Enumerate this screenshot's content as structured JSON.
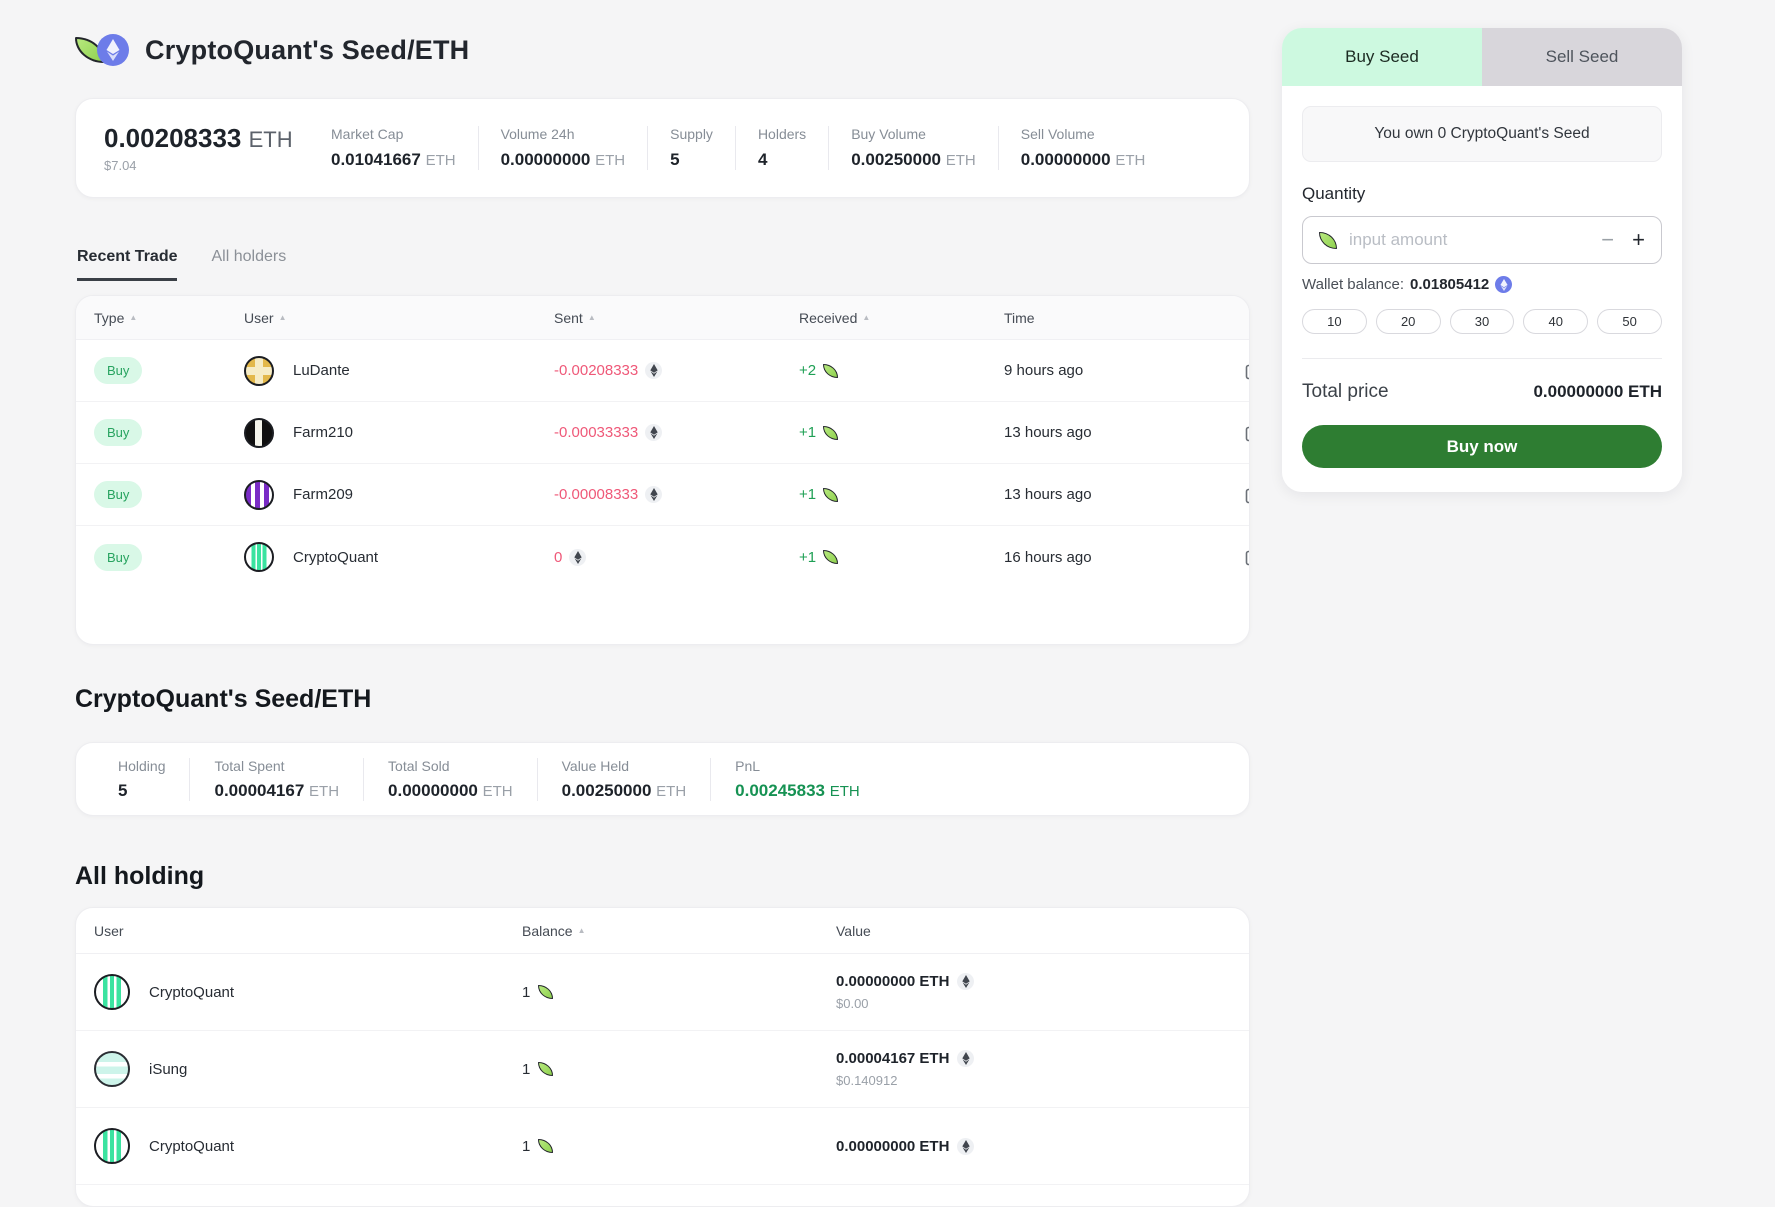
{
  "header": {
    "title": "CryptoQuant's Seed/ETH"
  },
  "stats": {
    "price": "0.00208333",
    "price_unit": "ETH",
    "price_usd": "$7.04",
    "items": [
      {
        "label": "Market Cap",
        "value": "0.01041667",
        "unit": "ETH"
      },
      {
        "label": "Volume 24h",
        "value": "0.00000000",
        "unit": "ETH"
      },
      {
        "label": "Supply",
        "value": "5",
        "unit": ""
      },
      {
        "label": "Holders",
        "value": "4",
        "unit": ""
      },
      {
        "label": "Buy Volume",
        "value": "0.00250000",
        "unit": "ETH"
      },
      {
        "label": "Sell Volume",
        "value": "0.00000000",
        "unit": "ETH"
      }
    ]
  },
  "tabs": {
    "recent_trade": "Recent Trade",
    "all_holders": "All holders"
  },
  "trades": {
    "columns": {
      "type": "Type",
      "user": "User",
      "sent": "Sent",
      "received": "Received",
      "time": "Time"
    },
    "rows": [
      {
        "type": "Buy",
        "user": "LuDante",
        "sent": "-0.00208333",
        "received": "+2",
        "time": "9 hours ago"
      },
      {
        "type": "Buy",
        "user": "Farm210",
        "sent": "-0.00033333",
        "received": "+1",
        "time": "13 hours ago"
      },
      {
        "type": "Buy",
        "user": "Farm209",
        "sent": "-0.00008333",
        "received": "+1",
        "time": "13 hours ago"
      },
      {
        "type": "Buy",
        "user": "CryptoQuant",
        "sent": "0",
        "received": "+1",
        "time": "16 hours ago"
      }
    ]
  },
  "position": {
    "title": "CryptoQuant's Seed/ETH",
    "items": [
      {
        "label": "Holding",
        "value": "5",
        "unit": ""
      },
      {
        "label": "Total Spent",
        "value": "0.00004167",
        "unit": "ETH"
      },
      {
        "label": "Total Sold",
        "value": "0.00000000",
        "unit": "ETH"
      },
      {
        "label": "Value Held",
        "value": "0.00250000",
        "unit": "ETH"
      },
      {
        "label": "PnL",
        "value": "0.00245833",
        "unit": "ETH"
      }
    ]
  },
  "holdings": {
    "title": "All holding",
    "columns": {
      "user": "User",
      "balance": "Balance",
      "value": "Value"
    },
    "rows": [
      {
        "user": "CryptoQuant",
        "balance": "1",
        "value_eth": "0.00000000 ETH",
        "value_usd": "$0.00"
      },
      {
        "user": "iSung",
        "balance": "1",
        "value_eth": "0.00004167 ETH",
        "value_usd": "$0.140912"
      },
      {
        "user": "CryptoQuant",
        "balance": "1",
        "value_eth": "0.00000000 ETH",
        "value_usd": ""
      }
    ]
  },
  "trade_panel": {
    "buy_tab": "Buy Seed",
    "sell_tab": "Sell Seed",
    "own_text": "You own 0 CryptoQuant's Seed",
    "quantity_label": "Quantity",
    "input_placeholder": "input amount",
    "minus": "−",
    "plus": "+",
    "wallet_balance_label": "Wallet balance:",
    "wallet_balance_value": "0.01805412",
    "quick_amounts": [
      "10",
      "20",
      "30",
      "40",
      "50"
    ],
    "total_price_label": "Total price",
    "total_price_value": "0.00000000 ETH",
    "buy_button": "Buy now"
  },
  "colors": {
    "accent_green": "#2e7d32",
    "buy_badge_bg": "#d9f8e7",
    "buy_badge_text": "#27a35f",
    "sent_red": "#ef5878",
    "received_green": "#1fa055",
    "pnl_green": "#169253",
    "buy_tab_bg": "#cdf9e0",
    "sell_tab_bg": "#d8d6db",
    "page_bg": "#f5f5f6"
  }
}
